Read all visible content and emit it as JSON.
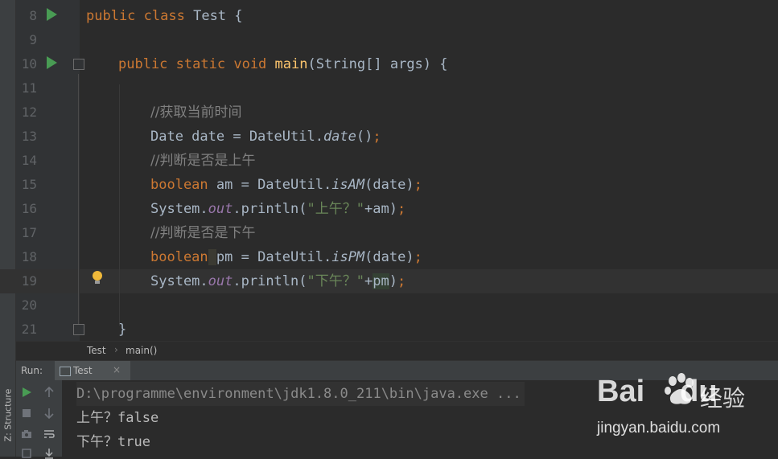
{
  "editor": {
    "lines": [
      {
        "n": "8"
      },
      {
        "n": "9"
      },
      {
        "n": "10"
      },
      {
        "n": "11"
      },
      {
        "n": "12"
      },
      {
        "n": "13"
      },
      {
        "n": "14"
      },
      {
        "n": "15"
      },
      {
        "n": "16"
      },
      {
        "n": "17"
      },
      {
        "n": "18"
      },
      {
        "n": "19"
      },
      {
        "n": "20"
      },
      {
        "n": "21"
      }
    ],
    "code": {
      "l8": {
        "kw1": "public",
        "kw2": "class",
        "rest": " Test {"
      },
      "l10": {
        "kw1": "public",
        "kw2": "static",
        "kw3": "void",
        "fn": "main",
        "rest": "(String[] args) {"
      },
      "l12": {
        "comment": "//获取当前时间"
      },
      "l13": {
        "pre": "Date date = DateUtil.",
        "method": "date",
        "post": "()",
        "semi": ";"
      },
      "l14": {
        "comment": "//判断是否是上午"
      },
      "l15": {
        "kw": "boolean",
        "pre": " am = DateUtil.",
        "method": "isAM",
        "post": "(date)",
        "semi": ";"
      },
      "l16": {
        "pre": "System.",
        "field": "out",
        "mid": ".println(",
        "str": "\"上午？\"",
        "post": "+am)",
        "semi": ";"
      },
      "l17": {
        "comment": "//判断是否是下午"
      },
      "l18": {
        "kw": "boolean",
        "sp": " ",
        "var": "pm",
        "pre": " = DateUtil.",
        "method": "isPM",
        "post": "(date)",
        "semi": ";"
      },
      "l19": {
        "pre": "System.",
        "field": "out",
        "mid": ".println(",
        "str": "\"下午？\"",
        "plus": "+",
        "var": "pm",
        "post": ")",
        "semi": ";"
      },
      "l21": {
        "brace": "}"
      }
    }
  },
  "breadcrumb": {
    "class": "Test",
    "sep": "›",
    "method": "main()"
  },
  "run_panel": {
    "label": "Run:",
    "tab": "Test",
    "close": "×"
  },
  "side_tab": {
    "label": "Z: Structure"
  },
  "console": {
    "command": "D:\\programme\\environment\\jdk1.8.0_211\\bin\\java.exe ...",
    "out1": "上午？false",
    "out2": "下午？true"
  },
  "watermark": {
    "logo": "Bai",
    "logo2": "du",
    "cn": "经验",
    "url": "jingyan.baidu.com"
  },
  "colors": {
    "keyword": "#cc7832",
    "method": "#ffc66d",
    "comment": "#808080",
    "string": "#6a8759",
    "field": "#9876aa",
    "run_icon": "#499c54"
  }
}
